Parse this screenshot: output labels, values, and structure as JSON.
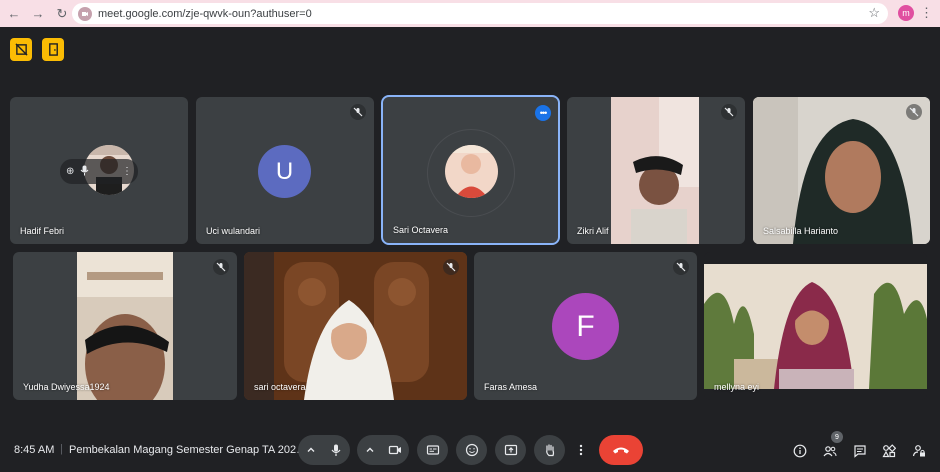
{
  "browser": {
    "url": "meet.google.com/zje-qwvk-oun?authuser=0",
    "profile_initial": "m"
  },
  "tiles": [
    {
      "name": "Hadif Febri"
    },
    {
      "name": "Uci wulandari",
      "initial": "U"
    },
    {
      "name": "Sari Octavera"
    },
    {
      "name": "Zikri Alif"
    },
    {
      "name": "Salsabilla Harianto"
    },
    {
      "name": "Yudha Dwiyessa1924"
    },
    {
      "name": "sari octavera"
    },
    {
      "name": "Faras Amesa",
      "initial": "F"
    },
    {
      "name": "mellyna eyi"
    }
  ],
  "bottom": {
    "time": "8:45 AM",
    "separator": "|",
    "meeting_title": "Pembekalan Magang Semester Genap TA 202…",
    "people_count": "9"
  },
  "colors": {
    "background": "#202124",
    "tile": "#3c4043",
    "accent_yellow": "#fbbc04",
    "avatar_u": "#5c6bc0",
    "avatar_f": "#ab47bc",
    "end_call": "#ea4335",
    "active_outline": "#8ab4f8"
  }
}
